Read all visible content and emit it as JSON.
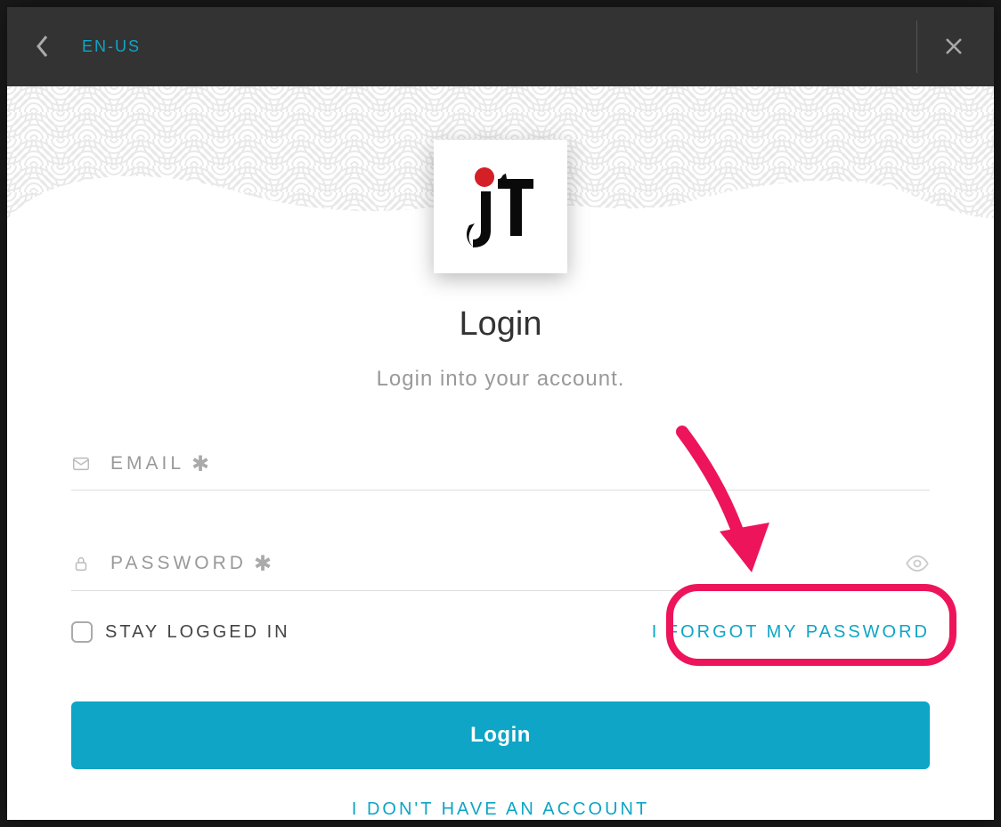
{
  "header": {
    "language": "EN-US"
  },
  "login": {
    "title": "Login",
    "subtitle": "Login into your account.",
    "email_label": "EMAIL",
    "password_label": "PASSWORD",
    "stay_logged_label": "STAY LOGGED IN",
    "forgot_link": "I FORGOT MY PASSWORD",
    "login_button": "Login",
    "no_account_link": "I DON'T HAVE AN ACCOUNT"
  },
  "annotation": {
    "highlight_target": "forgot-password-link",
    "color": "#ed145b"
  }
}
